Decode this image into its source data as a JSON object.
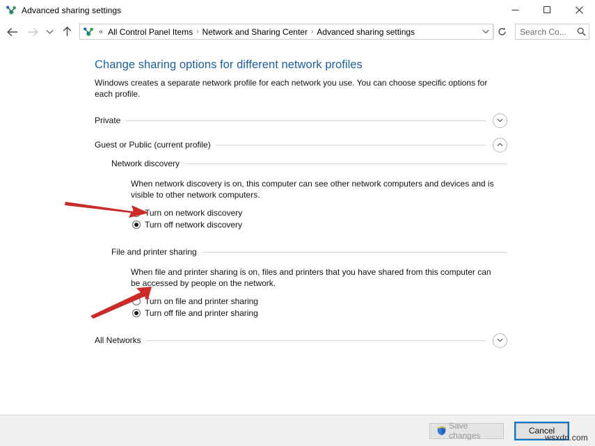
{
  "window": {
    "title": "Advanced sharing settings",
    "icon": "network-sharing-icon",
    "minimize_label": "─",
    "maximize_label": "☐",
    "close_label": "✕"
  },
  "navbar": {
    "back_icon": "back-arrow-icon",
    "forward_icon": "forward-arrow-icon",
    "recent_icon": "chevron-down-icon",
    "up_icon": "up-arrow-icon",
    "address_icon": "network-sharing-icon",
    "overflow": "«",
    "breadcrumbs": [
      "All Control Panel Items",
      "Network and Sharing Center",
      "Advanced sharing settings"
    ],
    "separator": "›",
    "dropdown_icon": "chevron-down-icon",
    "refresh_icon": "refresh-icon",
    "search": {
      "placeholder": "Search Co...",
      "value": "",
      "icon": "search-icon"
    }
  },
  "page": {
    "title": "Change sharing options for different network profiles",
    "description": "Windows creates a separate network profile for each network you use. You can choose specific options for each profile."
  },
  "profiles": [
    {
      "name": "Private",
      "expanded": false,
      "chevron": "chevron-down-icon"
    },
    {
      "name": "Guest or Public (current profile)",
      "expanded": true,
      "chevron": "chevron-up-icon"
    }
  ],
  "sections": [
    {
      "name": "Network discovery",
      "description": "When network discovery is on, this computer can see other network computers and devices and is visible to other network computers.",
      "options": [
        {
          "label": "Turn on network discovery",
          "selected": false
        },
        {
          "label": "Turn off network discovery",
          "selected": true
        }
      ]
    },
    {
      "name": "File and printer sharing",
      "description": "When file and printer sharing is on, files and printers that you have shared from this computer can be accessed by people on the network.",
      "options": [
        {
          "label": "Turn on file and printer sharing",
          "selected": false
        },
        {
          "label": "Turn off file and printer sharing",
          "selected": true
        }
      ]
    }
  ],
  "all_networks": {
    "name": "All Networks",
    "expanded": false,
    "chevron": "chevron-down-icon"
  },
  "footer": {
    "save_label": "Save changes",
    "save_enabled": false,
    "save_icon": "uac-shield-icon",
    "cancel_label": "Cancel",
    "watermark": "wsxdn.com"
  },
  "annotations": {
    "arrow_color": "#cc2a27",
    "arrows": [
      {
        "name": "arrow-to-turn-on-network-discovery"
      },
      {
        "name": "arrow-to-turn-on-file-printer-sharing"
      }
    ]
  },
  "colors": {
    "heading": "#1c5f9e",
    "focus": "#0078d7",
    "footer_bg": "#f0f0f0",
    "rule": "#d5d5d5"
  }
}
